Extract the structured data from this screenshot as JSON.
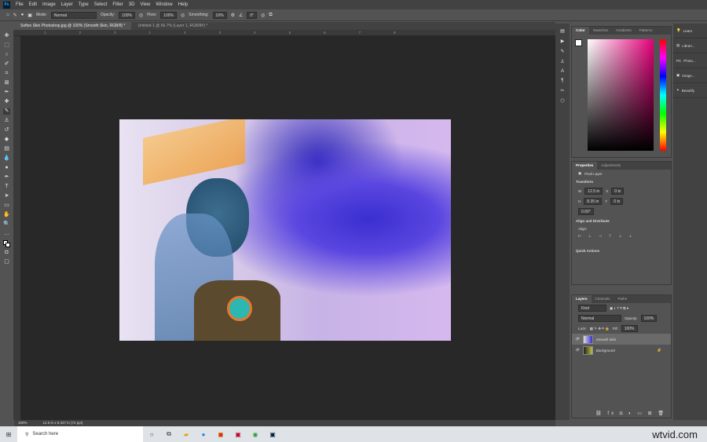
{
  "menu": [
    "File",
    "Edit",
    "Image",
    "Layer",
    "Type",
    "Select",
    "Filter",
    "3D",
    "View",
    "Window",
    "Help"
  ],
  "options": {
    "mode_label": "Mode:",
    "mode": "Normal",
    "opacity_label": "Opacity:",
    "opacity": "100%",
    "flow_label": "Flow:",
    "flow": "100%",
    "smoothing_label": "Smoothing:",
    "smoothing": "10%",
    "angle": "0°"
  },
  "tabs": [
    "Softex Skin Photoshop.jpg @ 100% (Smooth Skin, RGB/8) *",
    "Untitled-1 @ 66.7% (Layer 1, RGB/8#) *"
  ],
  "ruler_ticks": [
    "1",
    "2",
    "3",
    "1",
    "2",
    "3",
    "4",
    "5",
    "6",
    "7",
    "8"
  ],
  "status": {
    "zoom": "100%",
    "doc": "12.5 in x 8.347 in (72 ppi)"
  },
  "color_panel": {
    "tabs": [
      "Color",
      "Swatches",
      "Gradients",
      "Patterns"
    ]
  },
  "far_right": [
    "Learn",
    "Librari...",
    "Photo...",
    "Image...",
    "Beautify"
  ],
  "properties": {
    "tabs": [
      "Properties",
      "Adjustments"
    ],
    "kind": "Pixel Layer",
    "transform": "Transform",
    "w": "12.5 in",
    "h": "8.35 in",
    "x": "0 in",
    "y": "0 in",
    "angle": "0.00°",
    "align": "Align and Distribute",
    "align_sub": "Align:",
    "quick": "Quick Actions"
  },
  "layers": {
    "tabs": [
      "Layers",
      "Channels",
      "Paths"
    ],
    "kind": "Kind",
    "blend": "Normal",
    "opacity_label": "Opacity:",
    "opacity": "100%",
    "lock_label": "Lock:",
    "fill_label": "Fill:",
    "fill": "100%",
    "items": [
      "Smooth Skin",
      "Background"
    ]
  },
  "taskbar": {
    "search": "Search here",
    "watermark": "wtvid.com"
  }
}
